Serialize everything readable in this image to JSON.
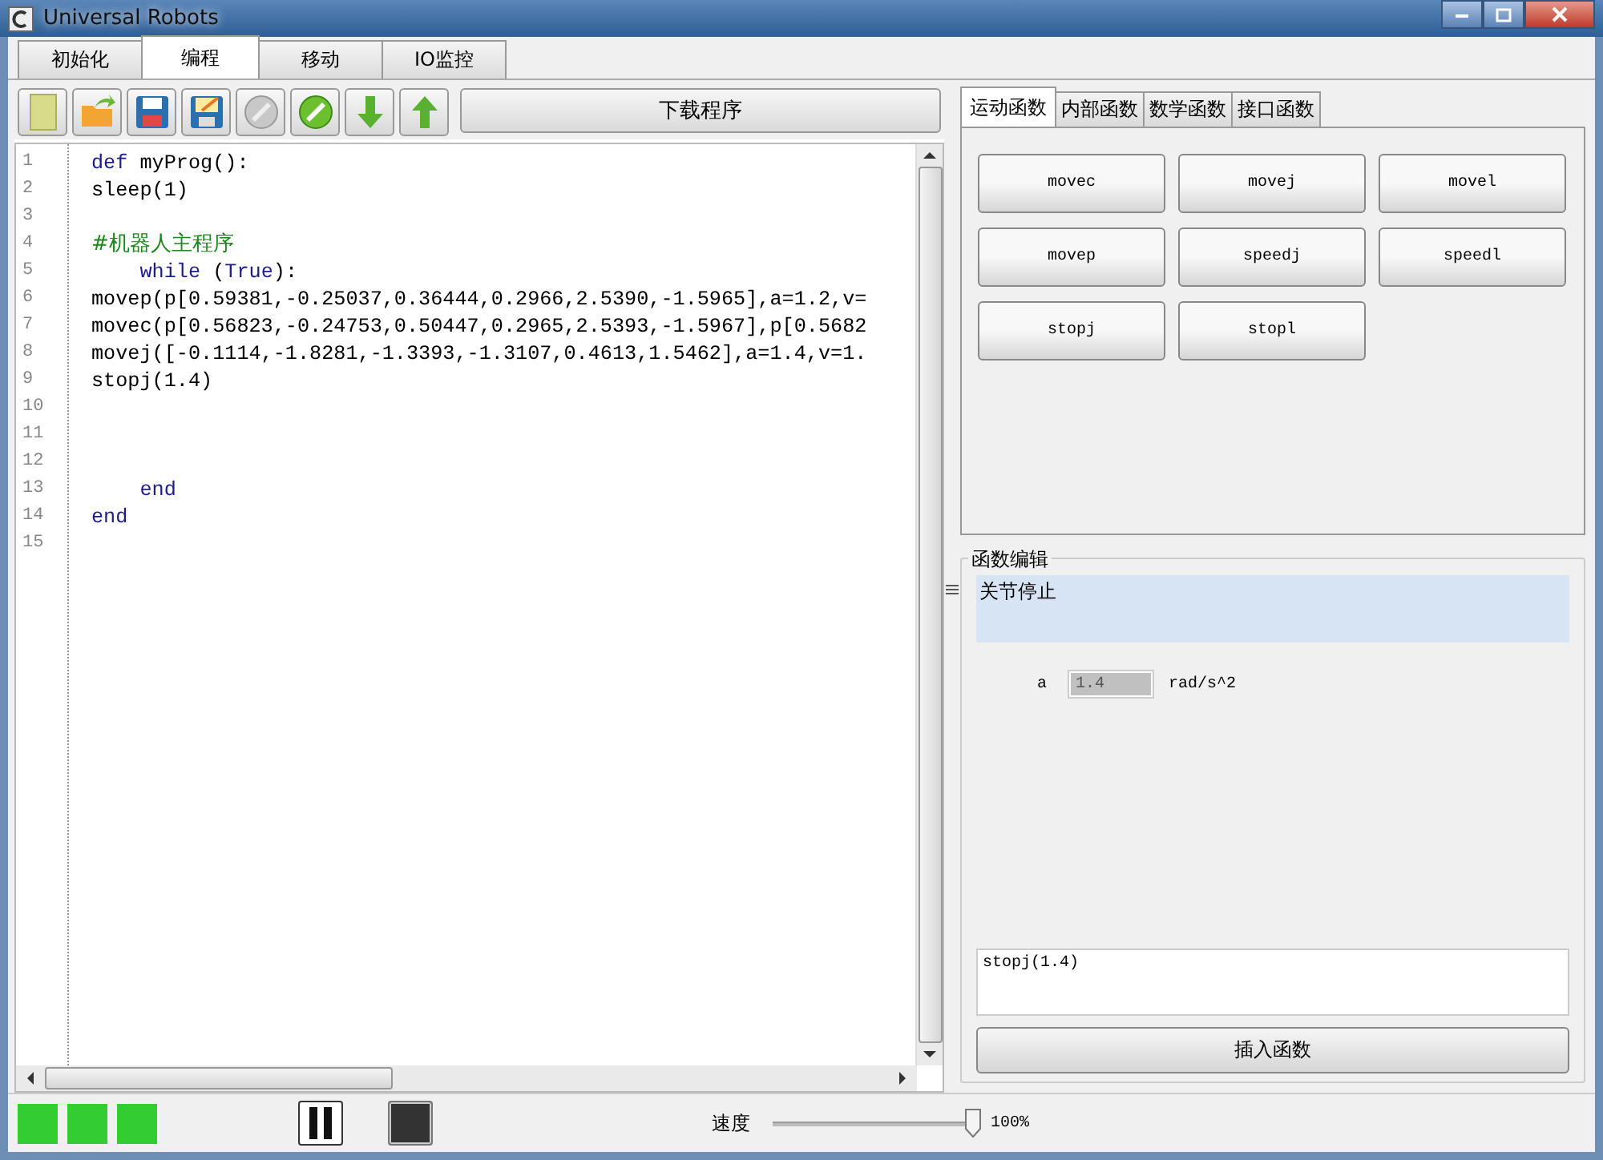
{
  "window": {
    "title": "Universal Robots"
  },
  "tabs": [
    {
      "label": "初始化",
      "selected": false
    },
    {
      "label": "编程",
      "selected": true
    },
    {
      "label": "移动",
      "selected": false
    },
    {
      "label": "IO监控",
      "selected": false
    }
  ],
  "toolbar": {
    "download_button": "下载程序"
  },
  "editor": {
    "lines": [
      {
        "number": "1",
        "segments": [
          {
            "kind": "keyword",
            "text": "def"
          },
          {
            "kind": "plain",
            "text": " myProg():"
          }
        ]
      },
      {
        "number": "2",
        "segments": [
          {
            "kind": "plain",
            "text": "sleep(1)"
          }
        ]
      },
      {
        "number": "3"
      },
      {
        "number": "4",
        "segments": [
          {
            "kind": "comment",
            "text": "#机器人主程序"
          }
        ]
      },
      {
        "number": "5",
        "segments": [
          {
            "kind": "keyword",
            "text": "    while"
          },
          {
            "kind": "plain",
            "text": " ("
          },
          {
            "kind": "keyword",
            "text": "True"
          },
          {
            "kind": "plain",
            "text": "):"
          }
        ]
      },
      {
        "number": "6",
        "segments": [
          {
            "kind": "plain",
            "text": "movep(p[0.59381,-0.25037,0.36444,0.2966,2.5390,-1.5965],a=1.2,v="
          }
        ]
      },
      {
        "number": "7",
        "segments": [
          {
            "kind": "plain",
            "text": "movec(p[0.56823,-0.24753,0.50447,0.2965,2.5393,-1.5967],p[0.5682"
          }
        ]
      },
      {
        "number": "8",
        "segments": [
          {
            "kind": "plain",
            "text": "movej([-0.1114,-1.8281,-1.3393,-1.3107,0.4613,1.5462],a=1.4,v=1."
          }
        ]
      },
      {
        "number": "9",
        "segments": [
          {
            "kind": "plain",
            "text": "stopj(1.4)"
          }
        ]
      },
      {
        "number": "10"
      },
      {
        "number": "11"
      },
      {
        "number": "12"
      },
      {
        "number": "13",
        "segments": [
          {
            "kind": "keyword",
            "text": "    end"
          }
        ]
      },
      {
        "number": "14",
        "segments": [
          {
            "kind": "keyword",
            "text": "end"
          }
        ]
      },
      {
        "number": "15"
      }
    ]
  },
  "function_tabs": [
    {
      "label": "运动函数",
      "selected": true
    },
    {
      "label": "内部函数",
      "selected": false
    },
    {
      "label": "数学函数",
      "selected": false
    },
    {
      "label": "接口函数",
      "selected": false
    }
  ],
  "function_buttons": [
    "movec",
    "movej",
    "movel",
    "movep",
    "speedj",
    "speedl",
    "stopj",
    "stopl"
  ],
  "function_editor": {
    "title": "函数编辑",
    "description": "关节停止",
    "param_label": "a",
    "param_value": "1.4",
    "param_unit": "rad/s^2",
    "preview": "stopj(1.4)",
    "insert_button": "插入函数"
  },
  "status_bar": {
    "speed_label": "速度",
    "speed": {
      "level": 1
    },
    "speed_reading": "100%"
  }
}
